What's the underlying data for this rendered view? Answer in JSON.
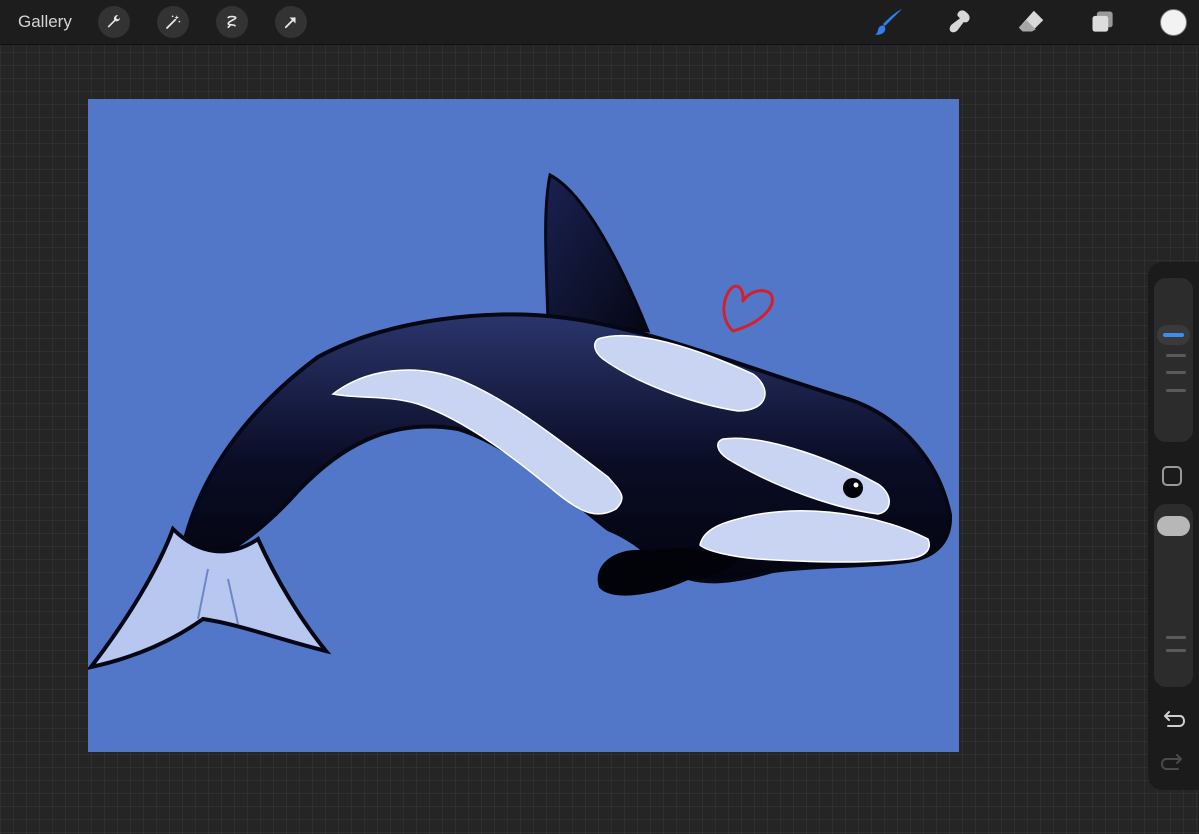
{
  "toolbar": {
    "gallery_label": "Gallery",
    "left_tools": [
      "wrench-icon",
      "magic-wand-icon",
      "selection-icon",
      "transform-arrow-icon"
    ],
    "right_tools": [
      "brush-icon",
      "smudge-icon",
      "eraser-icon",
      "layers-icon"
    ],
    "active_tool": "brush-icon",
    "active_color": "#2f7ff0",
    "current_color": "#f2f2f2"
  },
  "canvas": {
    "background_color": "#5277c8",
    "artwork": "orca-whale-drawing",
    "heart_color": "#d4202c"
  },
  "sidebar": {
    "brush_size_icon": "size-slider",
    "opacity_icon": "opacity-slider",
    "modify_icon": "square-icon",
    "undo_icon": "undo-icon",
    "redo_icon": "redo-icon"
  }
}
